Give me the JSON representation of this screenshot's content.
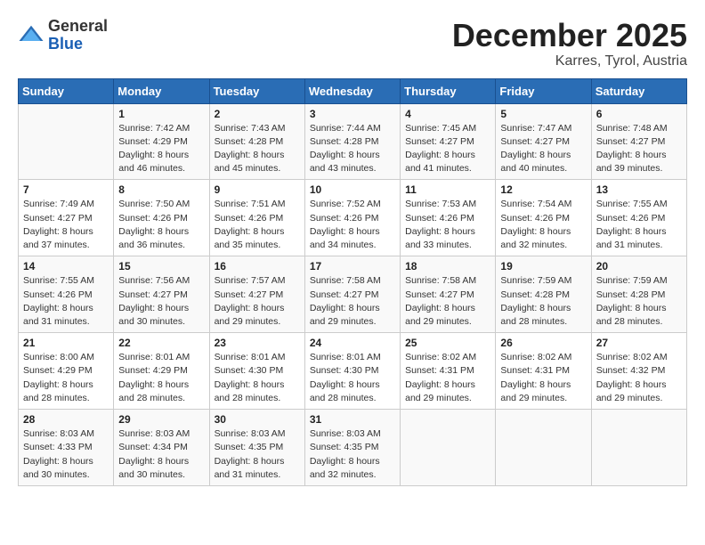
{
  "header": {
    "logo_general": "General",
    "logo_blue": "Blue",
    "month_title": "December 2025",
    "location": "Karres, Tyrol, Austria"
  },
  "weekdays": [
    "Sunday",
    "Monday",
    "Tuesday",
    "Wednesday",
    "Thursday",
    "Friday",
    "Saturday"
  ],
  "weeks": [
    [
      {
        "day": "",
        "sunrise": "",
        "sunset": "",
        "daylight": ""
      },
      {
        "day": "1",
        "sunrise": "Sunrise: 7:42 AM",
        "sunset": "Sunset: 4:29 PM",
        "daylight": "Daylight: 8 hours and 46 minutes."
      },
      {
        "day": "2",
        "sunrise": "Sunrise: 7:43 AM",
        "sunset": "Sunset: 4:28 PM",
        "daylight": "Daylight: 8 hours and 45 minutes."
      },
      {
        "day": "3",
        "sunrise": "Sunrise: 7:44 AM",
        "sunset": "Sunset: 4:28 PM",
        "daylight": "Daylight: 8 hours and 43 minutes."
      },
      {
        "day": "4",
        "sunrise": "Sunrise: 7:45 AM",
        "sunset": "Sunset: 4:27 PM",
        "daylight": "Daylight: 8 hours and 41 minutes."
      },
      {
        "day": "5",
        "sunrise": "Sunrise: 7:47 AM",
        "sunset": "Sunset: 4:27 PM",
        "daylight": "Daylight: 8 hours and 40 minutes."
      },
      {
        "day": "6",
        "sunrise": "Sunrise: 7:48 AM",
        "sunset": "Sunset: 4:27 PM",
        "daylight": "Daylight: 8 hours and 39 minutes."
      }
    ],
    [
      {
        "day": "7",
        "sunrise": "Sunrise: 7:49 AM",
        "sunset": "Sunset: 4:27 PM",
        "daylight": "Daylight: 8 hours and 37 minutes."
      },
      {
        "day": "8",
        "sunrise": "Sunrise: 7:50 AM",
        "sunset": "Sunset: 4:26 PM",
        "daylight": "Daylight: 8 hours and 36 minutes."
      },
      {
        "day": "9",
        "sunrise": "Sunrise: 7:51 AM",
        "sunset": "Sunset: 4:26 PM",
        "daylight": "Daylight: 8 hours and 35 minutes."
      },
      {
        "day": "10",
        "sunrise": "Sunrise: 7:52 AM",
        "sunset": "Sunset: 4:26 PM",
        "daylight": "Daylight: 8 hours and 34 minutes."
      },
      {
        "day": "11",
        "sunrise": "Sunrise: 7:53 AM",
        "sunset": "Sunset: 4:26 PM",
        "daylight": "Daylight: 8 hours and 33 minutes."
      },
      {
        "day": "12",
        "sunrise": "Sunrise: 7:54 AM",
        "sunset": "Sunset: 4:26 PM",
        "daylight": "Daylight: 8 hours and 32 minutes."
      },
      {
        "day": "13",
        "sunrise": "Sunrise: 7:55 AM",
        "sunset": "Sunset: 4:26 PM",
        "daylight": "Daylight: 8 hours and 31 minutes."
      }
    ],
    [
      {
        "day": "14",
        "sunrise": "Sunrise: 7:55 AM",
        "sunset": "Sunset: 4:26 PM",
        "daylight": "Daylight: 8 hours and 31 minutes."
      },
      {
        "day": "15",
        "sunrise": "Sunrise: 7:56 AM",
        "sunset": "Sunset: 4:27 PM",
        "daylight": "Daylight: 8 hours and 30 minutes."
      },
      {
        "day": "16",
        "sunrise": "Sunrise: 7:57 AM",
        "sunset": "Sunset: 4:27 PM",
        "daylight": "Daylight: 8 hours and 29 minutes."
      },
      {
        "day": "17",
        "sunrise": "Sunrise: 7:58 AM",
        "sunset": "Sunset: 4:27 PM",
        "daylight": "Daylight: 8 hours and 29 minutes."
      },
      {
        "day": "18",
        "sunrise": "Sunrise: 7:58 AM",
        "sunset": "Sunset: 4:27 PM",
        "daylight": "Daylight: 8 hours and 29 minutes."
      },
      {
        "day": "19",
        "sunrise": "Sunrise: 7:59 AM",
        "sunset": "Sunset: 4:28 PM",
        "daylight": "Daylight: 8 hours and 28 minutes."
      },
      {
        "day": "20",
        "sunrise": "Sunrise: 7:59 AM",
        "sunset": "Sunset: 4:28 PM",
        "daylight": "Daylight: 8 hours and 28 minutes."
      }
    ],
    [
      {
        "day": "21",
        "sunrise": "Sunrise: 8:00 AM",
        "sunset": "Sunset: 4:29 PM",
        "daylight": "Daylight: 8 hours and 28 minutes."
      },
      {
        "day": "22",
        "sunrise": "Sunrise: 8:01 AM",
        "sunset": "Sunset: 4:29 PM",
        "daylight": "Daylight: 8 hours and 28 minutes."
      },
      {
        "day": "23",
        "sunrise": "Sunrise: 8:01 AM",
        "sunset": "Sunset: 4:30 PM",
        "daylight": "Daylight: 8 hours and 28 minutes."
      },
      {
        "day": "24",
        "sunrise": "Sunrise: 8:01 AM",
        "sunset": "Sunset: 4:30 PM",
        "daylight": "Daylight: 8 hours and 28 minutes."
      },
      {
        "day": "25",
        "sunrise": "Sunrise: 8:02 AM",
        "sunset": "Sunset: 4:31 PM",
        "daylight": "Daylight: 8 hours and 29 minutes."
      },
      {
        "day": "26",
        "sunrise": "Sunrise: 8:02 AM",
        "sunset": "Sunset: 4:31 PM",
        "daylight": "Daylight: 8 hours and 29 minutes."
      },
      {
        "day": "27",
        "sunrise": "Sunrise: 8:02 AM",
        "sunset": "Sunset: 4:32 PM",
        "daylight": "Daylight: 8 hours and 29 minutes."
      }
    ],
    [
      {
        "day": "28",
        "sunrise": "Sunrise: 8:03 AM",
        "sunset": "Sunset: 4:33 PM",
        "daylight": "Daylight: 8 hours and 30 minutes."
      },
      {
        "day": "29",
        "sunrise": "Sunrise: 8:03 AM",
        "sunset": "Sunset: 4:34 PM",
        "daylight": "Daylight: 8 hours and 30 minutes."
      },
      {
        "day": "30",
        "sunrise": "Sunrise: 8:03 AM",
        "sunset": "Sunset: 4:35 PM",
        "daylight": "Daylight: 8 hours and 31 minutes."
      },
      {
        "day": "31",
        "sunrise": "Sunrise: 8:03 AM",
        "sunset": "Sunset: 4:35 PM",
        "daylight": "Daylight: 8 hours and 32 minutes."
      },
      {
        "day": "",
        "sunrise": "",
        "sunset": "",
        "daylight": ""
      },
      {
        "day": "",
        "sunrise": "",
        "sunset": "",
        "daylight": ""
      },
      {
        "day": "",
        "sunrise": "",
        "sunset": "",
        "daylight": ""
      }
    ]
  ]
}
